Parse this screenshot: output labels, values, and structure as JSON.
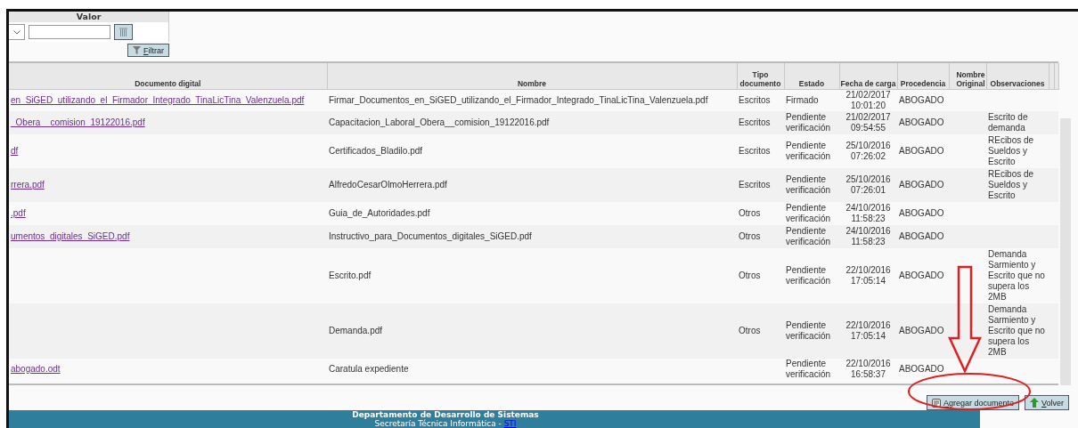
{
  "filter": {
    "column_header": "Valor",
    "filter_button": {
      "label": "Filtrar"
    }
  },
  "table": {
    "columns": [
      "Documento digital",
      "Nombre",
      "Tipo documento",
      "Estado",
      "Fecha de carga",
      "Procedencia",
      "Nombre Original",
      "Observaciones"
    ],
    "rows": [
      {
        "documento_digital": "en_SiGED_utilizando_el_Firmador_Integrado_TinaLicTina_Valenzuela.pdf",
        "nombre": "Firmar_Documentos_en_SiGED_utilizando_el_Firmador_Integrado_TinaLicTina_Valenzuela.pdf",
        "tipo": "Escritos",
        "estado": "Firmado",
        "fecha": "21/02/2017 10:01:20",
        "procedencia": "ABOGADO",
        "observaciones": ""
      },
      {
        "documento_digital": "_Obera__comision_19122016.pdf",
        "nombre": "Capacitacion_Laboral_Obera__comision_19122016.pdf",
        "tipo": "Escritos",
        "estado": "Pendiente verificación",
        "fecha": "21/02/2017 09:54:55",
        "procedencia": "ABOGADO",
        "observaciones": "Escrito de demanda"
      },
      {
        "documento_digital": "df",
        "nombre": "Certificados_Bladilo.pdf",
        "tipo": "Escritos",
        "estado": "Pendiente verificación",
        "fecha": "25/10/2016 07:26:02",
        "procedencia": "ABOGADO",
        "observaciones": "REcibos de Sueldos y Escrito"
      },
      {
        "documento_digital": "rrera.pdf",
        "nombre": "AlfredoCesarOlmoHerrera.pdf",
        "tipo": "Escritos",
        "estado": "Pendiente verificación",
        "fecha": "25/10/2016 07:26:01",
        "procedencia": "ABOGADO",
        "observaciones": "REcibos de Sueldos y Escrito"
      },
      {
        "documento_digital": ".pdf",
        "nombre": "Guia_de_Autoridades.pdf",
        "tipo": "Otros",
        "estado": "Pendiente verificación",
        "fecha": "24/10/2016 11:58:23",
        "procedencia": "ABOGADO",
        "observaciones": ""
      },
      {
        "documento_digital": "umentos_digitales_SiGED.pdf",
        "nombre": "Instructivo_para_Documentos_digitales_SiGED.pdf",
        "tipo": "Otros",
        "estado": "Pendiente verificación",
        "fecha": "24/10/2016 11:58:23",
        "procedencia": "ABOGADO",
        "observaciones": ""
      },
      {
        "documento_digital": "",
        "nombre": "Escrito.pdf",
        "tipo": "Otros",
        "estado": "Pendiente verificación",
        "fecha": "22/10/2016 17:05:14",
        "procedencia": "ABOGADO",
        "observaciones": "Demanda Sarmiento y Escrito que no supera los 2MB"
      },
      {
        "documento_digital": "",
        "nombre": "Demanda.pdf",
        "tipo": "Otros",
        "estado": "Pendiente verificación",
        "fecha": "22/10/2016 17:05:14",
        "procedencia": "ABOGADO",
        "observaciones": "Demanda Sarmiento y Escrito que no supera los 2MB"
      },
      {
        "documento_digital": "abogado.odt",
        "nombre": "Caratula expediente",
        "tipo": "",
        "estado": "Pendiente verificación",
        "fecha": "22/10/2016 16:58:37",
        "procedencia": "ABOGADO",
        "observaciones": ""
      }
    ]
  },
  "actions": [
    {
      "kind": "add",
      "label": "Agregar documento"
    },
    {
      "kind": "back",
      "label": "Volver"
    }
  ],
  "footer": {
    "title": "Departamento de Desarrollo de Sistemas",
    "subtitle": "Secretaría Técnica Informática - ",
    "link": "STI"
  }
}
